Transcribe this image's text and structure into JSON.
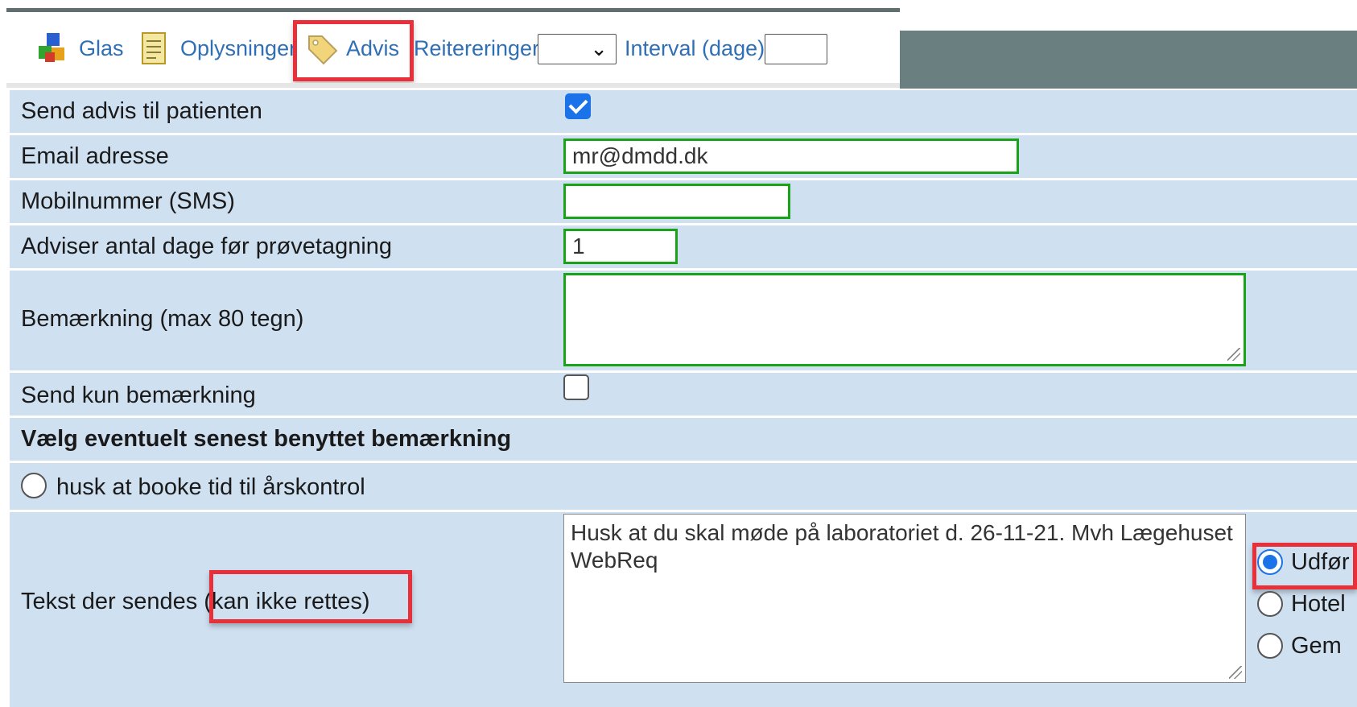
{
  "toolbar": {
    "glas_label": "Glas",
    "oplysninger_label": "Oplysninger",
    "advis_label": "Advis",
    "reitereringer_label": "Reitereringer",
    "reitereringer_selected": "",
    "interval_label": "Interval (dage)",
    "interval_value": ""
  },
  "form": {
    "send_advis_label": "Send advis til patienten",
    "send_advis_checked": true,
    "email_label": "Email adresse",
    "email_value": "mr@dmdd.dk",
    "mobil_label": "Mobilnummer (SMS)",
    "mobil_value": "",
    "dage_label": "Adviser antal dage før prøvetagning",
    "dage_value": "1",
    "bemaerkning_label": "Bemærkning (max 80 tegn)",
    "bemaerkning_value": "",
    "send_kun_label": "Send kun bemærkning",
    "send_kun_checked": false,
    "vaelg_label": "Vælg eventuelt senest benyttet bemærkning",
    "previous_remark_option": "husk at booke tid til årskontrol",
    "tekst_label_part1": "Tekst der sendes ",
    "tekst_label_part2": "(kan ikke rettes)",
    "tekst_value": "Husk at du skal møde på laboratoriet d. 26-11-21. Mvh Lægehuset WebReq",
    "actions": [
      {
        "label": "Udfør",
        "selected": true
      },
      {
        "label": "Hotel",
        "selected": false
      },
      {
        "label": "Gem",
        "selected": false
      }
    ]
  },
  "colors": {
    "highlight": "#e8303a",
    "row_bg": "#cfe0f1",
    "input_border": "#19a319",
    "link": "#2f6fb6",
    "header_dark": "#6a7f7f"
  }
}
